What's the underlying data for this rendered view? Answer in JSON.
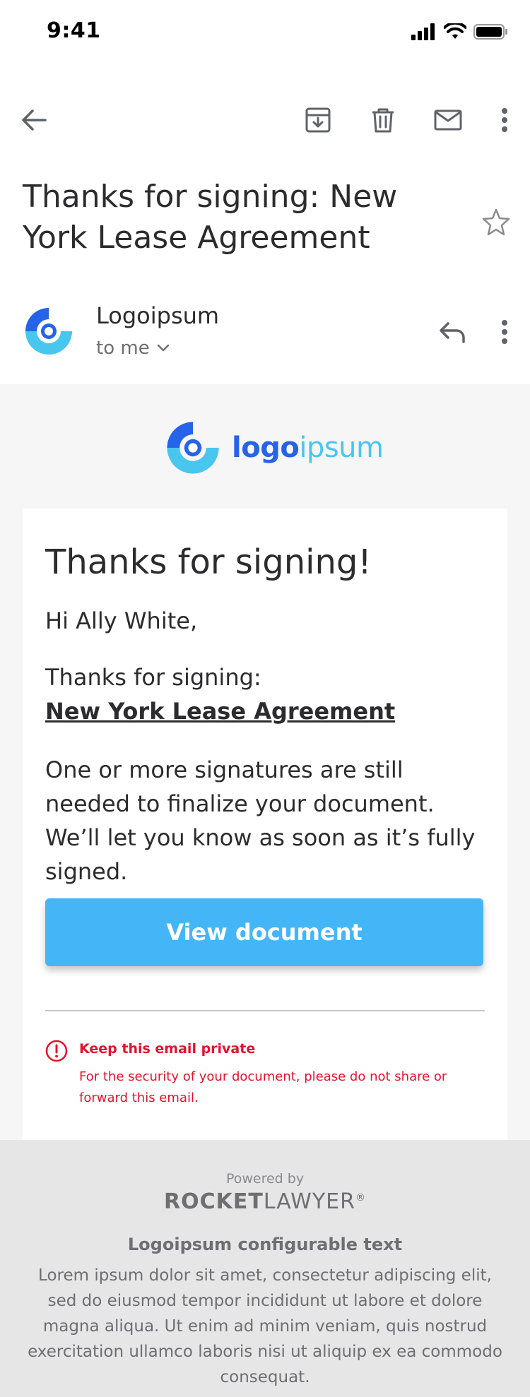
{
  "status_bar": {
    "time": "9:41",
    "icons": [
      "cellular-signal-icon",
      "wifi-icon",
      "battery-icon"
    ]
  },
  "toolbar": {
    "icons": [
      "back-arrow-icon",
      "archive-icon",
      "trash-icon",
      "mail-icon",
      "more-vertical-icon"
    ]
  },
  "subject": "Thanks for signing: New York Lease Agreement",
  "sender": {
    "name": "Logoipsum",
    "recipient": "to me"
  },
  "email": {
    "brand": {
      "part1": "logo",
      "part2": "ipsum"
    },
    "title": "Thanks for signing!",
    "greeting": "Hi Ally White,",
    "thanks_line": "Thanks for signing:",
    "document_name": "New York Lease Agreement",
    "message": "One or more signatures are still needed to finalize your document. We’ll let you know as soon as it’s fully signed.",
    "cta_label": "View document",
    "warning": {
      "title": "Keep this email private",
      "text": "For the security of your document, please do not share or forward this email."
    }
  },
  "footer": {
    "powered_by": "Powered by",
    "rl_part1": "ROCKET",
    "rl_part2": "LAWYER",
    "rl_mark": "®",
    "config_title": "Logoipsum configurable text",
    "config_text": "Lorem ipsum dolor sit amet, consectetur adipiscing elit, sed do eiusmod tempor incididunt ut labore et dolore magna aliqua. Ut enim ad minim veniam, quis nostrud exercitation ullamco laboris nisi ut aliquip ex ea commodo consequat."
  },
  "colors": {
    "brand_blue": "#2563e8",
    "brand_light_blue": "#48c6ee",
    "cta": "#44b6f8",
    "warning": "#e0142a"
  }
}
